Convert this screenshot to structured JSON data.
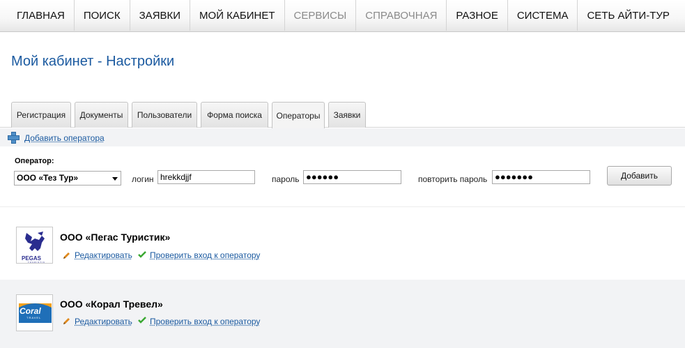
{
  "nav": {
    "items": [
      {
        "label": "ГЛАВНАЯ",
        "disabled": false
      },
      {
        "label": "ПОИСК",
        "disabled": false
      },
      {
        "label": "ЗАЯВКИ",
        "disabled": false
      },
      {
        "label": "МОЙ КАБИНЕТ",
        "disabled": false
      },
      {
        "label": "СЕРВИСЫ",
        "disabled": true
      },
      {
        "label": "СПРАВОЧНАЯ",
        "disabled": true
      },
      {
        "label": "РАЗНОЕ",
        "disabled": false
      },
      {
        "label": "СИСТЕМА",
        "disabled": false
      },
      {
        "label": "СЕТЬ АЙТИ-ТУР",
        "disabled": false
      }
    ]
  },
  "page": {
    "title": "Мой кабинет - Настройки"
  },
  "tabs": [
    {
      "label": "Регистрация"
    },
    {
      "label": "Документы"
    },
    {
      "label": "Пользователи"
    },
    {
      "label": "Форма поиска"
    },
    {
      "label": "Операторы"
    },
    {
      "label": "Заявки"
    }
  ],
  "active_tab": "Операторы",
  "add_operator": {
    "link_label": "Добавить оператора"
  },
  "form": {
    "operator_label": "Оператор:",
    "operator_value": "ООО «Тез Тур»",
    "login_label": "логин",
    "login_value": "hrekkdjjf",
    "password_label": "пароль",
    "password_value": "●●●●●●",
    "repeat_label": "повторить пароль",
    "repeat_value": "●●●●●●●",
    "submit_label": "Добавить"
  },
  "operators": [
    {
      "name": "ООО «Пегас Туристик»",
      "logo_text": "PEGAS",
      "logo_subtext": "TOURISTIK",
      "edit_label": "Редактировать",
      "check_label": "Проверить вход к оператору"
    },
    {
      "name": "ООО «Корал Тревел»",
      "logo_text": "Coral",
      "logo_subtext": "TRAVEL",
      "edit_label": "Редактировать",
      "check_label": "Проверить вход к оператору"
    }
  ],
  "colors": {
    "link": "#1b5aa0",
    "title": "#1b5aa0",
    "check_green": "#3aa832",
    "pencil_orange": "#e08a1e",
    "pegas_blue": "#2a2d8f",
    "coral_blue": "#1f6fb8"
  }
}
